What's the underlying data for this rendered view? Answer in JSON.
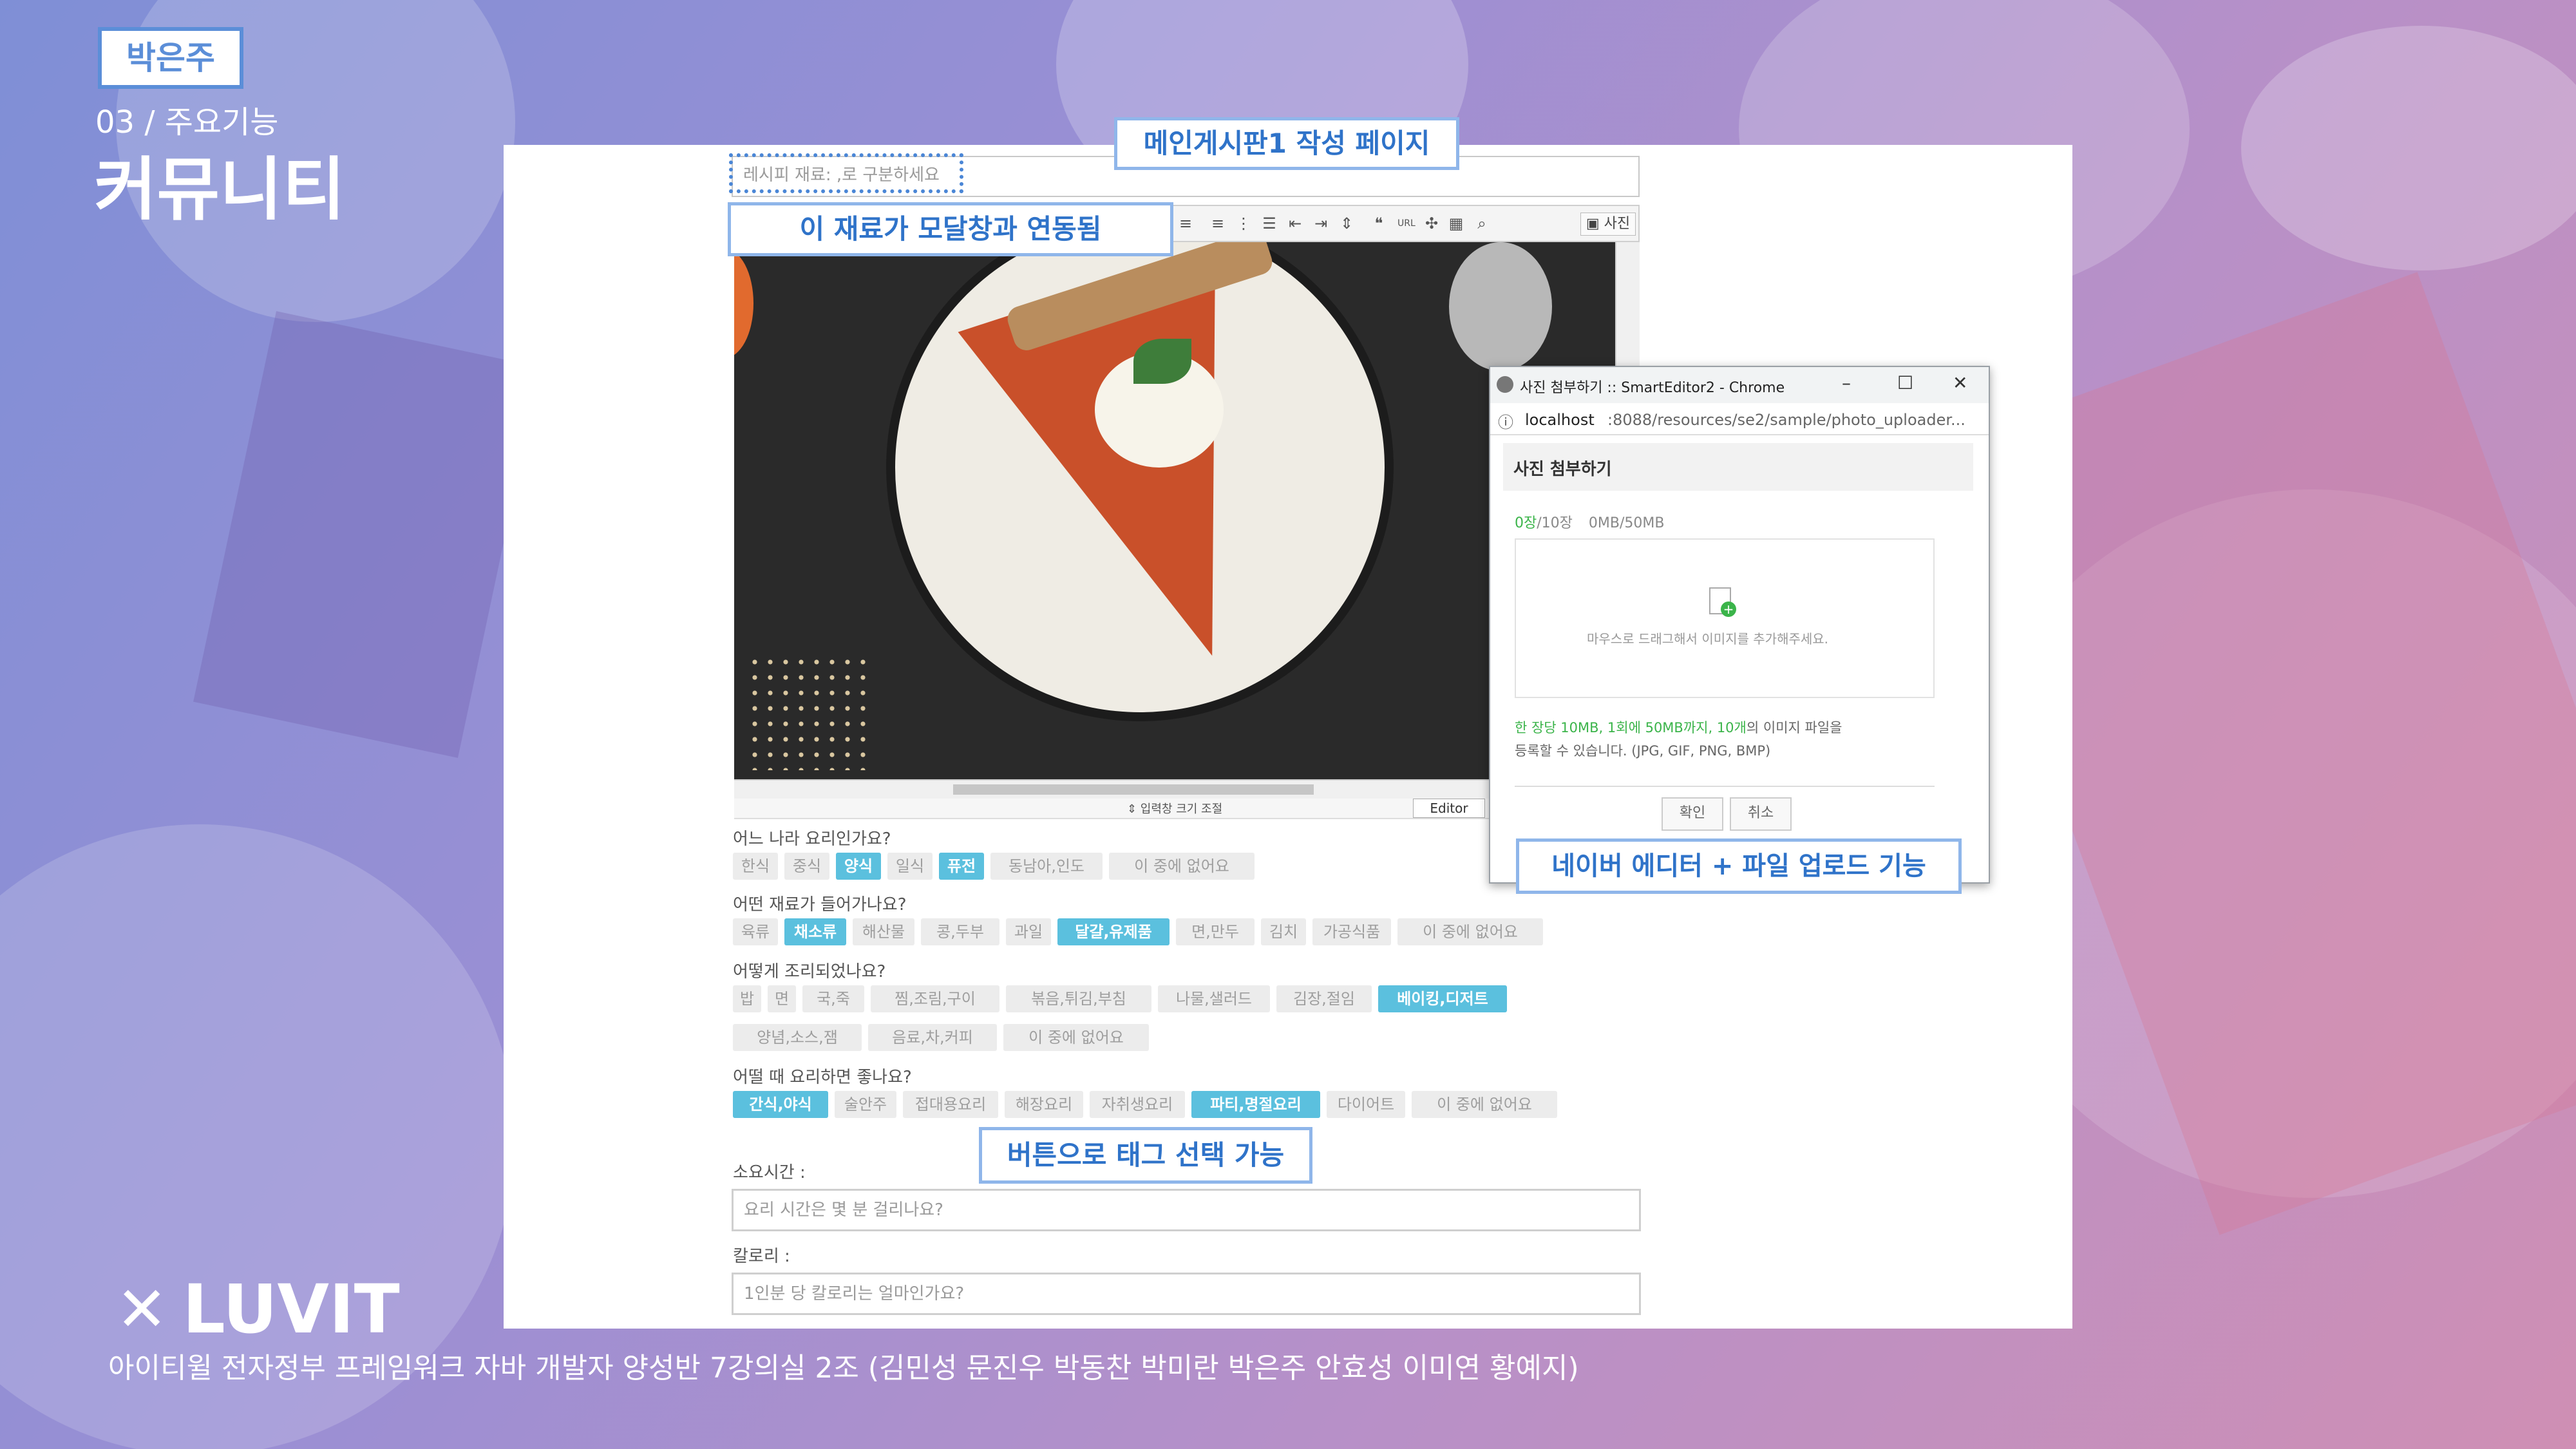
{
  "slide": {
    "author_badge": "박은주",
    "section": "03 / 주요기능",
    "heading": "커뮤니티",
    "logo_text": "LUVIT",
    "footer": "아이티윌 전자정부 프레임워크 자바 개발자 양성반 7강의실 2조 (김민성 문진우 박동찬 박미란 박은주 안효성 이미연 황예지)"
  },
  "callouts": {
    "main_board": "메인게시판1 작성 페이지",
    "ingredient_link": "이 재료가 모달창과 연동됨",
    "naver_editor": "네이버 에디터 + 파일 업로드 기능",
    "tag_select": "버튼으로 태그 선택 가능"
  },
  "editor": {
    "ingredient_placeholder": "레시피 재료: ,로 구분하세요",
    "photo_button": "사진",
    "resize_label": "⇕ 입력창 크기 조절",
    "mode_label": "Editor"
  },
  "questions": [
    {
      "label": "어느 나라 요리인가요?",
      "tags": [
        {
          "t": "한식",
          "on": false
        },
        {
          "t": "중식",
          "on": false
        },
        {
          "t": "양식",
          "on": true
        },
        {
          "t": "일식",
          "on": false
        },
        {
          "t": "퓨전",
          "on": true
        },
        {
          "t": "동남아,인도",
          "on": false
        },
        {
          "t": "이 중에 없어요",
          "on": false
        }
      ]
    },
    {
      "label": "어떤 재료가 들어가나요?",
      "tags": [
        {
          "t": "육류",
          "on": false
        },
        {
          "t": "채소류",
          "on": true
        },
        {
          "t": "해산물",
          "on": false
        },
        {
          "t": "콩,두부",
          "on": false
        },
        {
          "t": "과일",
          "on": false
        },
        {
          "t": "달걀,유제품",
          "on": true
        },
        {
          "t": "면,만두",
          "on": false
        },
        {
          "t": "김치",
          "on": false
        },
        {
          "t": "가공식품",
          "on": false
        },
        {
          "t": "이 중에 없어요",
          "on": false
        }
      ]
    },
    {
      "label": "어떻게 조리되었나요?",
      "tags": [
        {
          "t": "밥",
          "on": false
        },
        {
          "t": "면",
          "on": false
        },
        {
          "t": "국,죽",
          "on": false
        },
        {
          "t": "찜,조림,구이",
          "on": false
        },
        {
          "t": "볶음,튀김,부침",
          "on": false
        },
        {
          "t": "나물,샐러드",
          "on": false
        },
        {
          "t": "김장,절임",
          "on": false
        },
        {
          "t": "베이킹,디저트",
          "on": true
        },
        {
          "t": "양념,소스,잼",
          "on": false
        },
        {
          "t": "음료,차,커피",
          "on": false
        },
        {
          "t": "이 중에 없어요",
          "on": false
        }
      ]
    },
    {
      "label": "어떨 때 요리하면 좋나요?",
      "tags": [
        {
          "t": "간식,야식",
          "on": true
        },
        {
          "t": "술안주",
          "on": false
        },
        {
          "t": "접대용요리",
          "on": false
        },
        {
          "t": "해장요리",
          "on": false
        },
        {
          "t": "자취생요리",
          "on": false
        },
        {
          "t": "파티,명절요리",
          "on": true
        },
        {
          "t": "다이어트",
          "on": false
        },
        {
          "t": "이 중에 없어요",
          "on": false
        }
      ]
    }
  ],
  "fields": {
    "time_label": "소요시간 :",
    "time_placeholder": "요리 시간은 몇 분 걸리나요?",
    "calorie_label": "칼로리 :",
    "calorie_placeholder": "1인분 당 칼로리는 얼마인가요?"
  },
  "popup": {
    "window_title": "사진 첨부하기 :: SmartEditor2 - Chrome",
    "url_host": "localhost",
    "url_rest": ":8088/resources/se2/sample/photo_uploader...",
    "header": "사진 첨부하기",
    "count_used": "0장",
    "count_total": "/10장",
    "size_used": "0MB",
    "size_total": "/50MB",
    "drop_hint": "마우스로 드래그해서 이미지를 추가해주세요.",
    "limit_green": "한 장당 10MB, 1회에 50MB까지, 10개",
    "limit_rest": "의 이미지 파일을",
    "limit_line2": "등록할 수 있습니다. (JPG, GIF, PNG, BMP)",
    "ok": "확인",
    "cancel": "취소"
  },
  "colors": {
    "accent": "#5b8ed8",
    "tag_on": "#5bc0de",
    "green": "#3bb44a"
  }
}
